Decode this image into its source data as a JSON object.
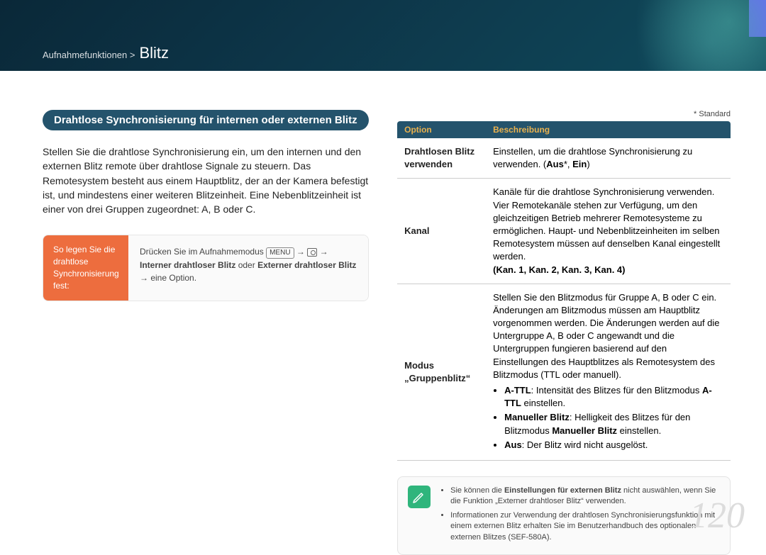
{
  "breadcrumb": {
    "section": "Aufnahmefunktionen >",
    "title": "Blitz"
  },
  "pill": "Drahtlose Synchronisierung für internen oder externen Blitz",
  "intro": "Stellen Sie die drahtlose Synchronisierung ein, um den internen und den externen Blitz remote über drahtlose Signale zu steuern. Das Remotesystem besteht aus einem Hauptblitz, der an der Kamera befestigt ist, und mindestens einer weiteren Blitzeinheit. Eine Nebenblitzeinheit ist einer von drei Gruppen zugeordnet: A, B oder C.",
  "instr": {
    "left": "So legen Sie die drahtlose Synchronisierung fest:",
    "right_pre": "Drücken Sie im Aufnahmemodus ",
    "menu": "MENU",
    "mid1": "Interner drahtloser Blitz",
    "or": " oder ",
    "mid2": "Externer drahtloser Blitz",
    "tail": " eine Option."
  },
  "standard": "* Standard",
  "th1": "Option",
  "th2": "Beschreibung",
  "rows": {
    "r1": {
      "opt": "Drahtlosen Blitz verwenden",
      "desc": "Einstellen, um die drahtlose Synchronisierung zu verwenden. (",
      "b1": "Aus",
      "star": "*, ",
      "b2": "Ein",
      "close": ")"
    },
    "r2": {
      "opt": "Kanal",
      "desc": "Kanäle für die drahtlose Synchronisierung verwenden. Vier Remotekanäle stehen zur Verfügung, um den gleichzeitigen Betrieb mehrerer Remotesysteme zu ermöglichen. Haupt- und Nebenblitzeinheiten im selben Remotesystem müssen auf denselben Kanal eingestellt werden.",
      "bold": "(Kan. 1, Kan. 2, Kan. 3, Kan. 4)"
    },
    "r3": {
      "opt": "Modus „Gruppenblitz“",
      "p": "Stellen Sie den Blitzmodus für Gruppe A, B oder C ein. Änderungen am Blitzmodus müssen am Hauptblitz vorgenommen werden. Die Änderungen werden auf die Untergruppe A, B oder C angewandt und die Untergruppen fungieren basierend auf den Einstellungen des Hauptblitzes als Remotesystem des Blitzmodus (TTL oder manuell).",
      "li1a": "A-TTL",
      "li1b": ": Intensität des Blitzes für den Blitzmodus ",
      "li1c": "A-TTL",
      "li1d": " einstellen.",
      "li2a": "Manueller Blitz",
      "li2b": ": Helligkeit des Blitzes für den Blitzmodus ",
      "li2c": "Manueller Blitz",
      "li2d": " einstellen.",
      "li3a": "Aus",
      "li3b": ": Der Blitz wird nicht ausgelöst."
    }
  },
  "notes": {
    "n1a": "Sie können die ",
    "n1b": "Einstellungen für externen Blitz",
    "n1c": " nicht auswählen, wenn Sie die Funktion „Externer drahtloser Blitz“ verwenden.",
    "n2": "Informationen zur Verwendung der drahtlosen Synchronisierungsfunktion mit einem externen Blitz erhalten Sie im Benutzerhandbuch des optionalen externen Blitzes (SEF-580A)."
  },
  "page": "120"
}
